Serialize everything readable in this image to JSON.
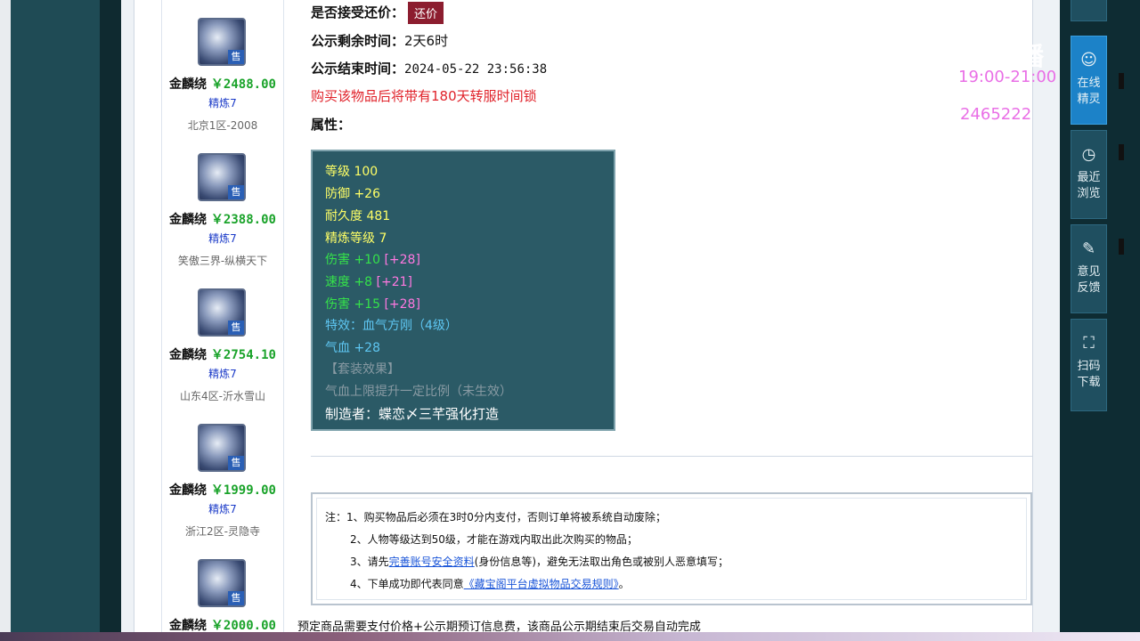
{
  "listings": [
    {
      "name": "金麟绕",
      "price": "￥2488.00",
      "refine": "精炼7",
      "server": "北京1区-2008",
      "badge": "售"
    },
    {
      "name": "金麟绕",
      "price": "￥2388.00",
      "refine": "精炼7",
      "server": "笑傲三界-纵横天下",
      "badge": "售"
    },
    {
      "name": "金麟绕",
      "price": "￥2754.10",
      "refine": "精炼7",
      "server": "山东4区-沂水雪山",
      "badge": "售"
    },
    {
      "name": "金麟绕",
      "price": "￥1999.00",
      "refine": "精炼7",
      "server": "浙江2区-灵隐寺",
      "badge": "售"
    },
    {
      "name": "金麟绕",
      "price": "￥2000.00",
      "refine": "",
      "server": "",
      "badge": "售"
    }
  ],
  "detail": {
    "bargain_label": "是否接受还价：",
    "bargain_button": "还价",
    "remain_label": "公示剩余时间：",
    "remain_value": "2天6时",
    "end_label": "公示结束时间：",
    "end_value": "2024-05-22 23:56:38",
    "warning": "购买该物品后将带有180天转服时间锁",
    "attr_label": "属性："
  },
  "attributes": {
    "level": "等级 100",
    "defense": "防御 +26",
    "durability": "耐久度 481",
    "refine_level": "精炼等级 7",
    "damage1": "伤害 +10",
    "damage1_bonus": "[+28]",
    "speed": "速度 +8",
    "speed_bonus": "[+21]",
    "damage2": "伤害 +15",
    "damage2_bonus": "[+28]",
    "effect": "特效：血气方刚（4级）",
    "hp": "气血 +28",
    "set_effect": "【套装效果】",
    "set_desc": "气血上限提升一定比例（未生效）",
    "maker": "制造者：蝶恋〆三芊强化打造"
  },
  "notes": {
    "n1": "注：1、购买物品后必须在3时0分内支付，否则订单将被系统自动废除；",
    "n2": "2、人物等级达到50级，才能在游戏内取出此次购买的物品；",
    "n3_pre": "3、请先",
    "n3_link": "完善账号安全资料",
    "n3_post": "(身份信息等)，避免无法取出角色或被别人恶意填写；",
    "n4_pre": "4、下单成功即代表同意",
    "n4_link": "《藏宝阁平台虚拟物品交易规则》",
    "n4_post": "。"
  },
  "bottom_text": "预定商品需要支付价格+公示期预订信息费，该商品公示期结束后交易自动完成",
  "right_panel": {
    "online": "在线精灵",
    "recent": "最近浏览",
    "feedback": "意见反馈",
    "scan": "扫码下载"
  },
  "overlay": {
    "time": "19:00-21:00",
    "number": "2465222",
    "watermark": "CC直播"
  }
}
